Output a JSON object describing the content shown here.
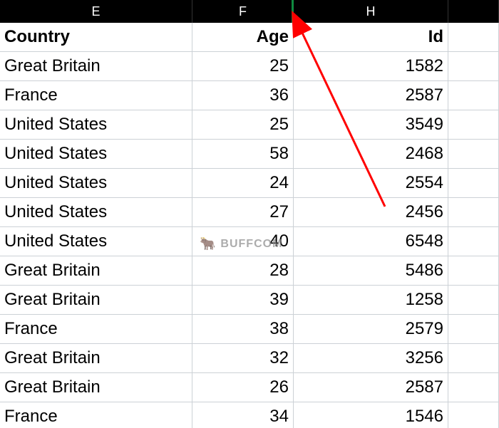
{
  "columns": {
    "e": "E",
    "f": "F",
    "h": "H"
  },
  "headers": {
    "country": "Country",
    "age": "Age",
    "id": "Id"
  },
  "rows": [
    {
      "country": "Great Britain",
      "age": 25,
      "id": 1582
    },
    {
      "country": "France",
      "age": 36,
      "id": 2587
    },
    {
      "country": "United States",
      "age": 25,
      "id": 3549
    },
    {
      "country": "United States",
      "age": 58,
      "id": 2468
    },
    {
      "country": "United States",
      "age": 24,
      "id": 2554
    },
    {
      "country": "United States",
      "age": 27,
      "id": 2456
    },
    {
      "country": "United States",
      "age": 40,
      "id": 6548
    },
    {
      "country": "Great Britain",
      "age": 28,
      "id": 5486
    },
    {
      "country": "Great Britain",
      "age": 39,
      "id": 1258
    },
    {
      "country": "France",
      "age": 38,
      "id": 2579
    },
    {
      "country": "Great Britain",
      "age": 32,
      "id": 3256
    },
    {
      "country": "Great Britain",
      "age": 26,
      "id": 2587
    },
    {
      "country": "France",
      "age": 34,
      "id": 1546
    }
  ],
  "watermark": {
    "text": "BUFFCOM",
    "icon": "🐂"
  },
  "annotation": {
    "color": "#ff0000"
  }
}
